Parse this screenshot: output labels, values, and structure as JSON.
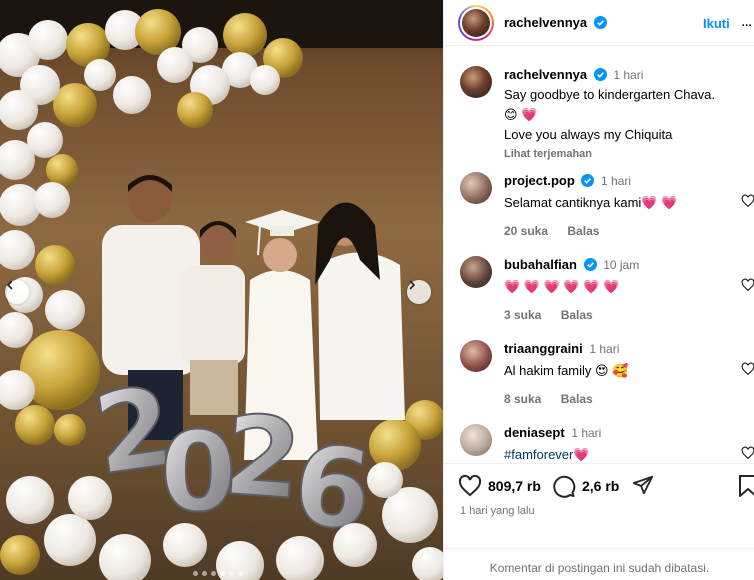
{
  "post": {
    "author": "rachelvennya",
    "follow_label": "Ikuti",
    "more_label": "...",
    "caption": {
      "username": "rachelvennya",
      "time": "1 hari",
      "line1": "Say goodbye to kindergarten Chava.",
      "line2": "😊 💗",
      "line3": "Love you always my Chiquita",
      "translate_label": "Lihat terjemahan"
    },
    "photo_number_decoration": "2026"
  },
  "comments": [
    {
      "username": "project.pop",
      "verified": true,
      "time": "1 hari",
      "text": "Selamat cantiknya kami💗 💗",
      "likes": "20 suka",
      "reply": "Balas"
    },
    {
      "username": "bubahalfian",
      "verified": true,
      "time": "10 jam",
      "text": "💗 💗 💗 💗 💗 💗",
      "likes": "3 suka",
      "reply": "Balas"
    },
    {
      "username": "triaanggraini",
      "verified": false,
      "time": "1 hari",
      "text": "Al hakim family 😍 🥰",
      "likes": "8 suka",
      "reply": "Balas"
    },
    {
      "username": "deniasept",
      "verified": false,
      "time": "1 hari",
      "text": "#famforever💗",
      "likes": "",
      "reply": ""
    }
  ],
  "stats": {
    "likes": "809,7 rb",
    "comments": "2,6 rb",
    "posted": "1 hari yang lalu"
  },
  "footer": {
    "text": "Komentar di postingan ini sudah dibatasi."
  },
  "carousel": {
    "count": 6,
    "active": 4
  },
  "colors": {
    "accent": "#0095f6",
    "verified": "#0095f6",
    "muted": "#737373",
    "heart": "#ed4956"
  },
  "icons": [
    "chevron-left-icon",
    "chevron-right-icon",
    "verified-badge-icon",
    "heart-icon",
    "comment-icon",
    "share-icon",
    "bookmark-icon"
  ]
}
